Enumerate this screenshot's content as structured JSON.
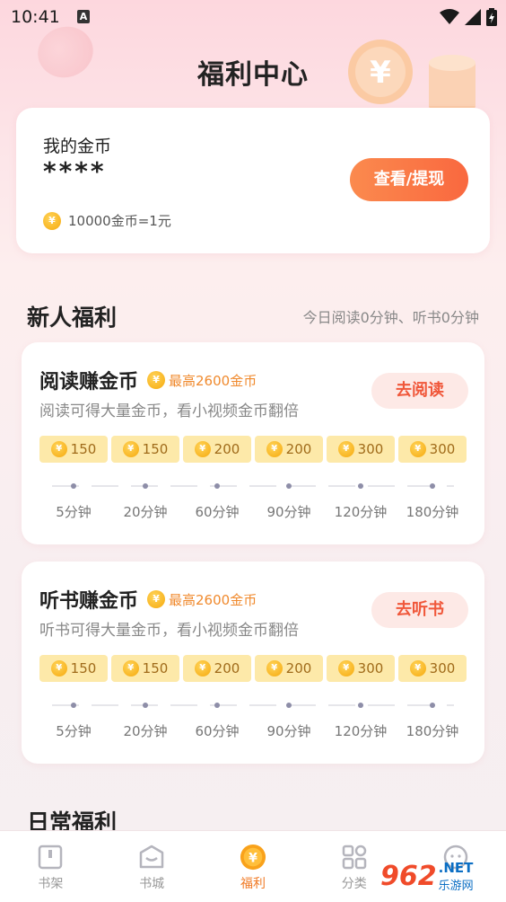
{
  "status": {
    "time": "10:41",
    "a_icon": "A"
  },
  "header": {
    "title": "福利中心"
  },
  "coin_card": {
    "label": "我的金币",
    "amount": "****",
    "coin_glyph": "¥",
    "rate": "10000金币=1元",
    "withdraw_label": "查看/提现"
  },
  "newbie": {
    "title": "新人福利",
    "subtitle": "今日阅读0分钟、听书0分钟",
    "tasks": [
      {
        "title": "阅读赚金币",
        "max": "最高2600金币",
        "desc": "阅读可得大量金币，看小视频金币翻倍",
        "button": "去阅读",
        "rewards": [
          "150",
          "150",
          "200",
          "200",
          "300",
          "300"
        ],
        "times": [
          "5分钟",
          "20分钟",
          "60分钟",
          "90分钟",
          "120分钟",
          "180分钟"
        ]
      },
      {
        "title": "听书赚金币",
        "max": "最高2600金币",
        "desc": "听书可得大量金币，看小视频金币翻倍",
        "button": "去听书",
        "rewards": [
          "150",
          "150",
          "200",
          "200",
          "300",
          "300"
        ],
        "times": [
          "5分钟",
          "20分钟",
          "60分钟",
          "90分钟",
          "120分钟",
          "180分钟"
        ]
      }
    ]
  },
  "daily": {
    "title": "日常福利"
  },
  "nav": {
    "items": [
      {
        "label": "书架",
        "icon": "bookshelf-icon"
      },
      {
        "label": "书城",
        "icon": "bookstore-icon"
      },
      {
        "label": "福利",
        "icon": "welfare-coin-icon"
      },
      {
        "label": "分类",
        "icon": "category-icon"
      },
      {
        "label": "",
        "icon": "profile-icon"
      }
    ]
  },
  "watermark": {
    "logo": "962",
    "net": ".NET",
    "cn": "乐游网"
  },
  "colors": {
    "accent": "#f9683f",
    "coin": "#f6a90c",
    "chip": "#fde9a9",
    "button_bg": "#fde9e6",
    "button_text": "#f0573a",
    "active_nav": "#f07a25"
  }
}
